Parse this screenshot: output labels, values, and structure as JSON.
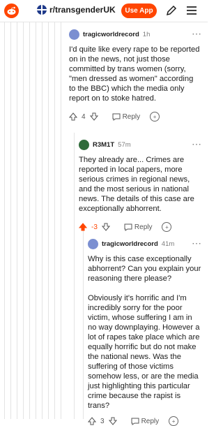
{
  "header": {
    "subreddit": "r/transgenderUK",
    "use_app_label": "Use App",
    "colors": {
      "brand": "#ff4500"
    }
  },
  "comments": [
    {
      "author": "tragicworldrecord",
      "time": "1h",
      "body": [
        "I'd quite like every rape to be reported on in the news, not just those committed by trans women (sorry, \"men dressed as women\" according to the BBC) which the media only report on to stoke hatred."
      ],
      "score": "4",
      "reply_label": "Reply",
      "icons": [
        "avatar",
        "more-icon",
        "upvote-icon",
        "downvote-icon",
        "reply-icon",
        "award-icon"
      ]
    },
    {
      "author": "R3M1T",
      "time": "57m",
      "body": [
        "They already are... Crimes are reported in local papers, more serious crimes in regional news, and the most serious in national news. The details of this case are exceptionally abhorrent."
      ],
      "score": "-3",
      "score_color": "#ff4500",
      "reply_label": "Reply"
    },
    {
      "author": "tragicworldrecord",
      "time": "41m",
      "body": [
        "Why is this case exceptionally abhorrent? Can you explain your reasoning there please?",
        "Obviously it's horrific and I'm incredibly sorry for the poor victim, whose suffering I am in no way downplaying. However a lot of rapes take place which are equally horrific but do not make the national news. Was the suffering of those victims somehow less, or are the media just highlighting this particular crime because the rapist is trans?"
      ],
      "score": "3",
      "reply_label": "Reply"
    }
  ]
}
